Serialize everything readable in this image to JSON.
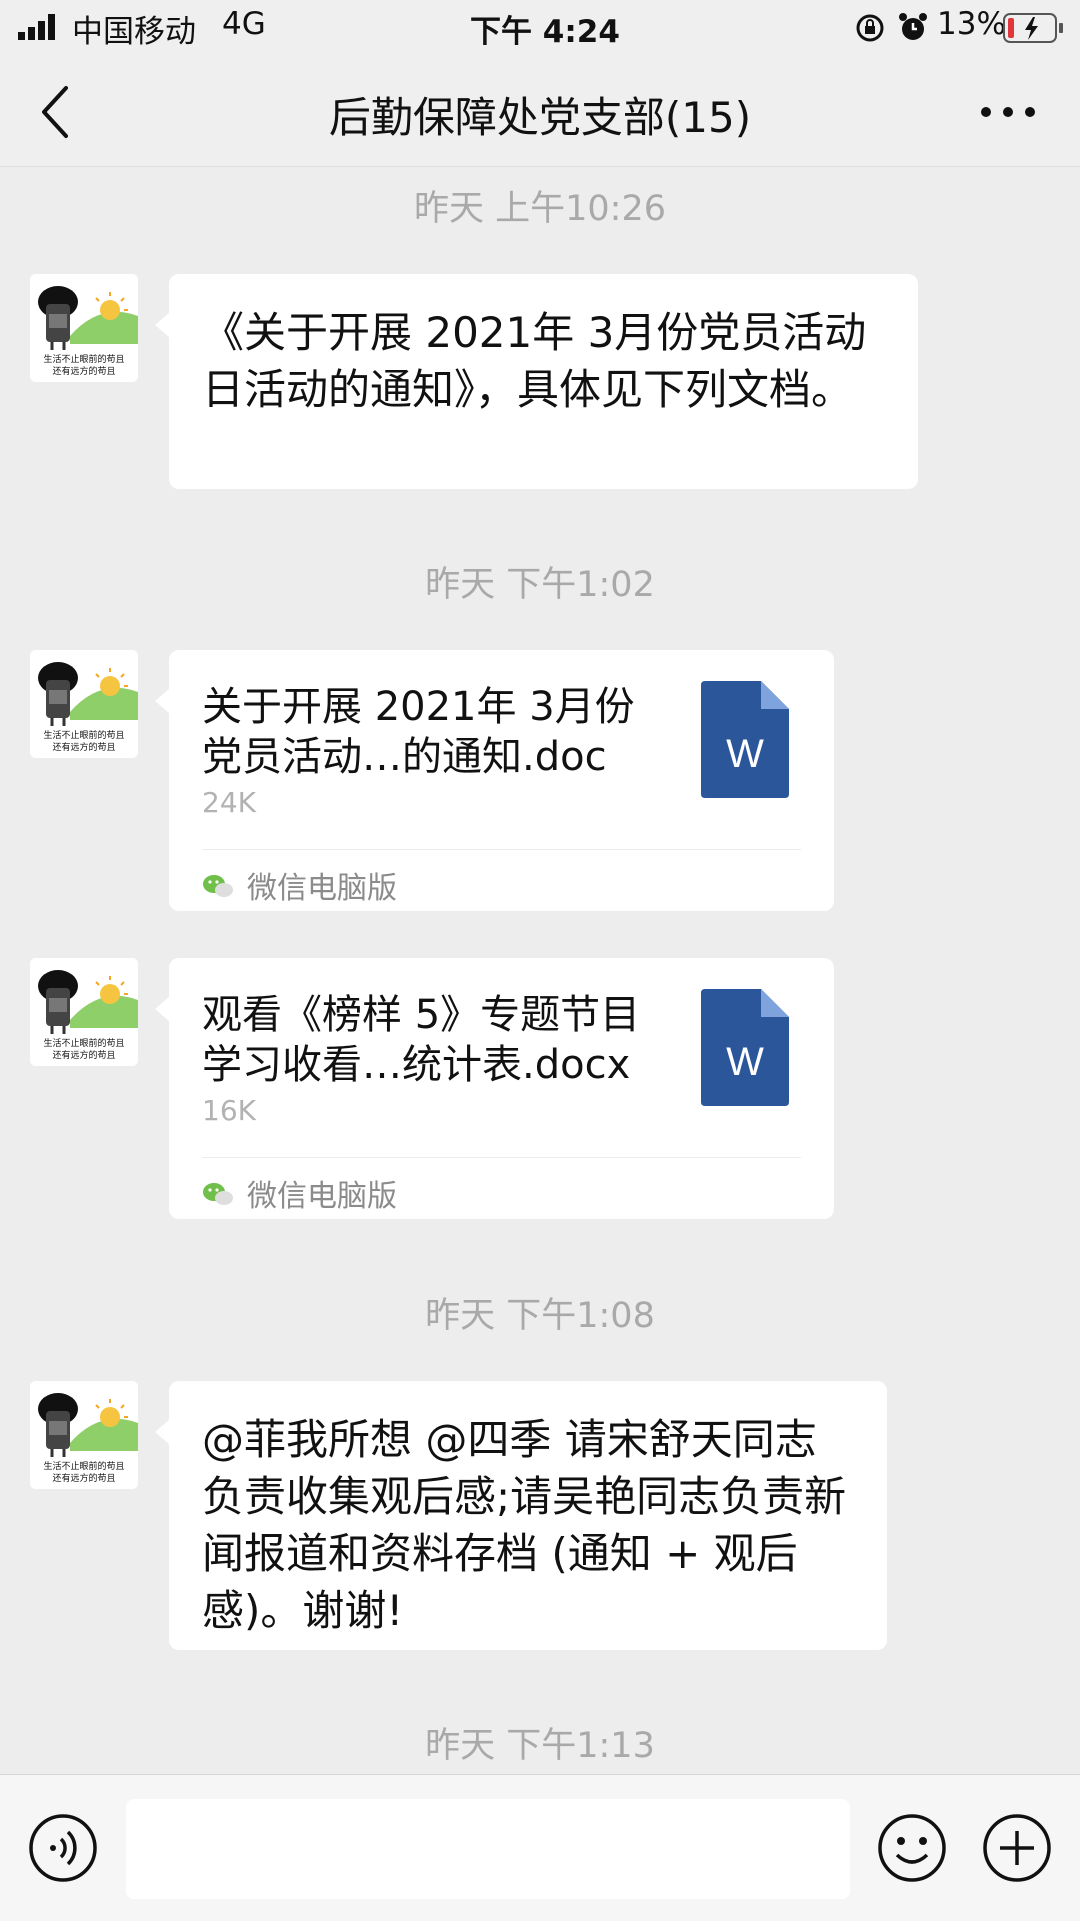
{
  "status_bar": {
    "carrier": "中国移动",
    "network": "4G",
    "time": "下午 4:24",
    "battery": "13%"
  },
  "header": {
    "title": "后勤保障处党支部(15)",
    "back_icon": "chevron-left-icon",
    "more_icon": "more-dots-icon"
  },
  "avatar": {
    "line1": "生活不止眼前的苟且",
    "line2": "还有远方的苟且"
  },
  "messages": [
    {
      "type": "time",
      "text": "昨天 上午10:26"
    },
    {
      "type": "text",
      "text": "《关于开展 2021年 3月份党员活动日活动的通知》，具体见下列文档。"
    },
    {
      "type": "time",
      "text": "昨天 下午1:02"
    },
    {
      "type": "file",
      "name": "关于开展 2021年 3月份党员活动…的通知.doc",
      "size": "24K",
      "source": "微信电脑版",
      "icon_letter": "W"
    },
    {
      "type": "file",
      "name": "观看《榜样 5》专题节目学习收看…统计表.docx",
      "size": "16K",
      "source": "微信电脑版",
      "icon_letter": "W"
    },
    {
      "type": "time",
      "text": "昨天 下午1:08"
    },
    {
      "type": "text",
      "text": "@菲我所想 @四季 请宋舒天同志负责收集观后感;请吴艳同志负责新闻报道和资料存档 (通知 + 观后感)。谢谢!"
    },
    {
      "type": "time",
      "text": "昨天 下午1:13"
    }
  ],
  "input_bar": {
    "voice_icon": "voice-icon",
    "emoji_icon": "emoji-icon",
    "plus_icon": "plus-icon"
  },
  "colors": {
    "background": "#ededed",
    "bubble": "#ffffff",
    "word_icon": "#2b579a",
    "battery_low": "#e0353b"
  }
}
